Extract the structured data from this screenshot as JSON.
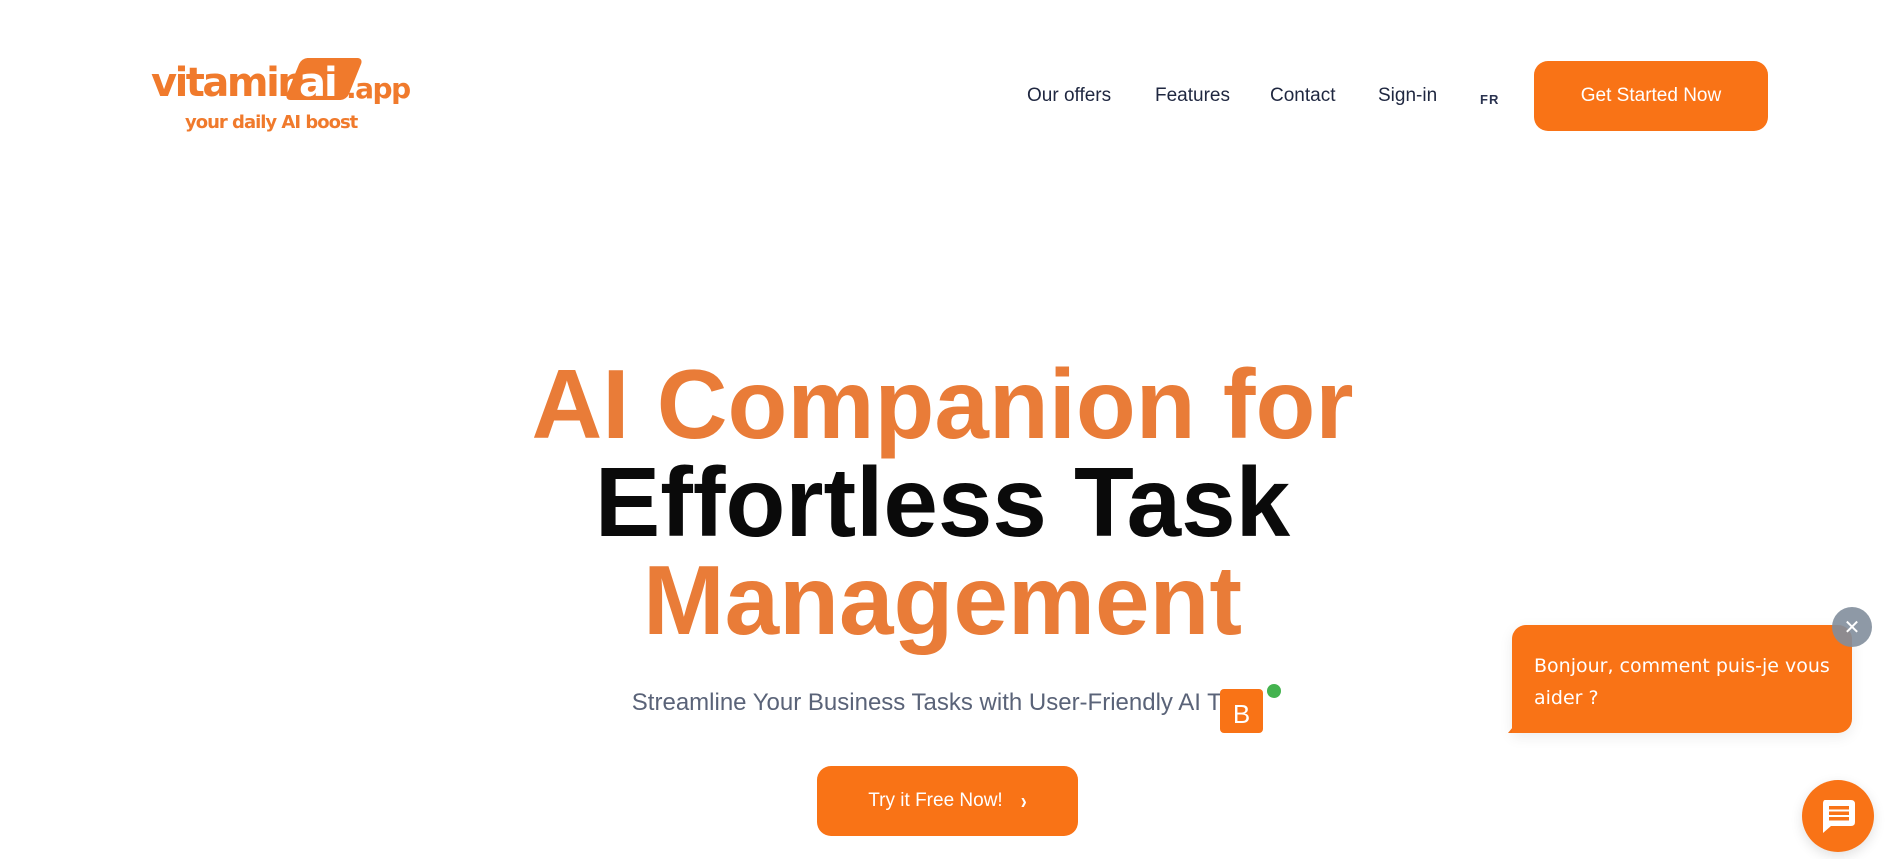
{
  "header": {
    "logo": {
      "word": "vitamin",
      "highlight": "ai",
      "suffix": ".app",
      "tagline": "your daily AI boost"
    },
    "nav": [
      {
        "label": "Our offers"
      },
      {
        "label": "Features"
      },
      {
        "label": "Contact"
      },
      {
        "label": "Sign-in"
      }
    ],
    "language": "FR",
    "cta_label": "Get Started Now"
  },
  "hero": {
    "title_lines": [
      {
        "text": "AI Companion for",
        "color": "orange"
      },
      {
        "text": "Effortless Task",
        "color": "black"
      },
      {
        "text": "Management",
        "color": "orange"
      }
    ],
    "subtitle": "Streamline Your Business Tasks with User-Friendly AI Tools",
    "cta_label": "Try it Free Now!",
    "cta_icon": "chevron-right-icon"
  },
  "chat_widget": {
    "avatar_letter": "B",
    "status": "online",
    "greeting": "Bonjour, comment puis-je vous aider ?",
    "close_icon": "close-icon",
    "launcher_icon": "chat-message-icon"
  },
  "colors": {
    "brand_orange": "#f97316",
    "title_orange": "#e97c38",
    "text_dark": "#1f2740",
    "subtitle_gray": "#5a6378",
    "online_green": "#44b34f"
  }
}
